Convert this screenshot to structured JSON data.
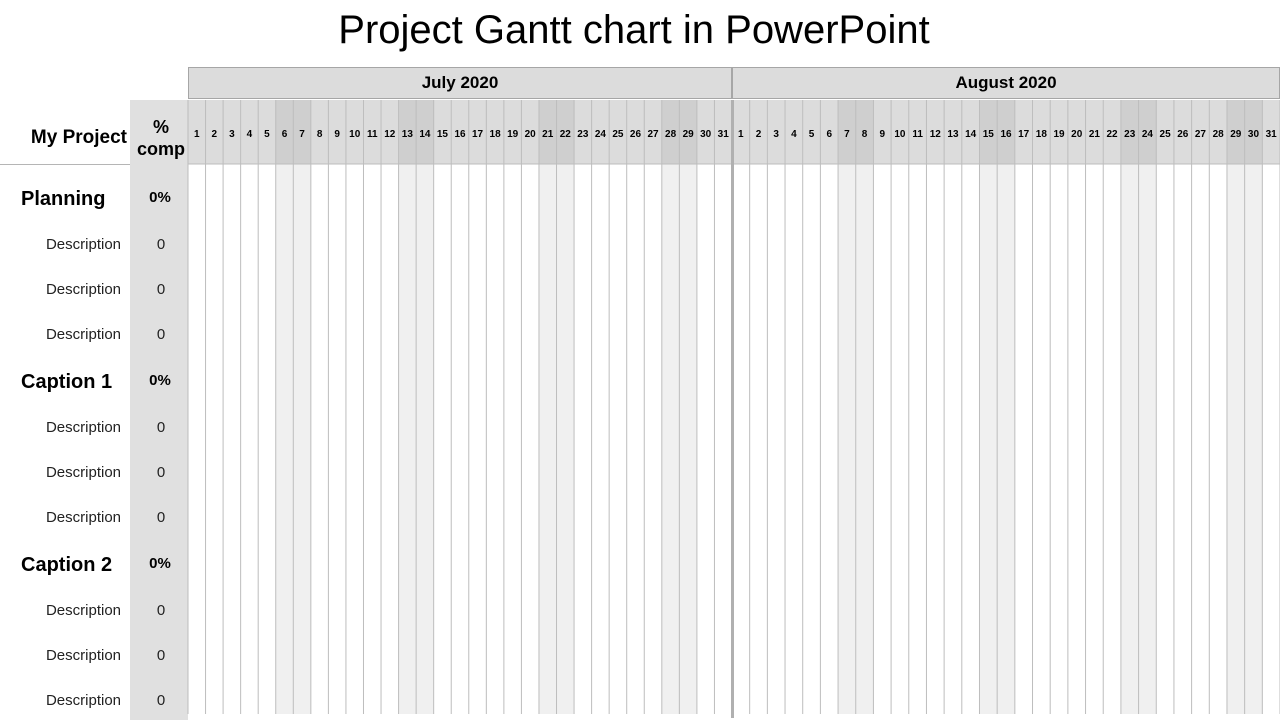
{
  "title": "Project Gantt chart in PowerPoint",
  "header": {
    "project_label": "My Project",
    "pct_label_line1": "%",
    "pct_label_line2": "comp"
  },
  "colors": {
    "header_fill": "#dcdcdc",
    "weekend_header_fill": "#cfcfcf",
    "weekend_body_fill": "#f0f0f0",
    "grid_line": "#bdbdbd",
    "pct_column_fill": "#e0e0e0"
  },
  "chart_data": {
    "type": "table",
    "title": "Project Gantt chart in PowerPoint",
    "months": [
      {
        "label": "July 2020",
        "days": 31,
        "shaded_days": [
          6,
          7,
          13,
          14,
          21,
          22,
          28,
          29
        ]
      },
      {
        "label": "August 2020",
        "days": 31,
        "shaded_days": [
          7,
          8,
          15,
          16,
          23,
          24,
          29,
          30
        ]
      }
    ],
    "rows": [
      {
        "type": "section",
        "label": "Planning",
        "pct": "0%"
      },
      {
        "type": "task",
        "label": "Description",
        "pct": "0"
      },
      {
        "type": "task",
        "label": "Description",
        "pct": "0"
      },
      {
        "type": "task",
        "label": "Description",
        "pct": "0"
      },
      {
        "type": "section",
        "label": "Caption 1",
        "pct": "0%"
      },
      {
        "type": "task",
        "label": "Description",
        "pct": "0"
      },
      {
        "type": "task",
        "label": "Description",
        "pct": "0"
      },
      {
        "type": "task",
        "label": "Description",
        "pct": "0"
      },
      {
        "type": "section",
        "label": "Caption 2",
        "pct": "0%"
      },
      {
        "type": "task",
        "label": "Description",
        "pct": "0"
      },
      {
        "type": "task",
        "label": "Description",
        "pct": "0"
      },
      {
        "type": "task",
        "label": "Description",
        "pct": "0"
      }
    ],
    "bars": []
  }
}
